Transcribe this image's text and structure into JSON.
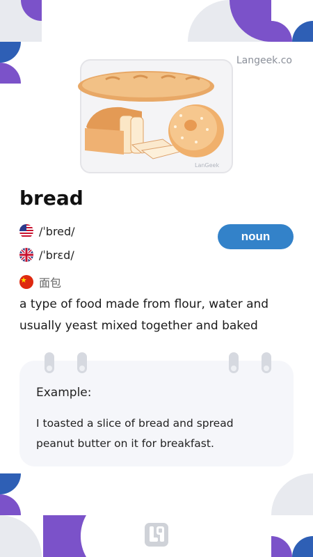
{
  "brand": {
    "name": "Langeek.co"
  },
  "illustration": {
    "icon": "bread-illustration",
    "watermark": "LanGeek"
  },
  "entry": {
    "word": "bread",
    "part_of_speech": "noun",
    "pronunciations": [
      {
        "flag": "us-flag-icon",
        "ipa": "/ˈbred/"
      },
      {
        "flag": "uk-flag-icon",
        "ipa": "/ˈbrɛd/"
      }
    ],
    "translation": {
      "flag": "china-flag-icon",
      "text": "面包"
    },
    "definition": "a type of food made from flour, water and usually yeast mixed together and baked"
  },
  "example": {
    "label": "Example:",
    "text": "I toasted a slice of bread and spread peanut butter on it for breakfast."
  },
  "colors": {
    "purple": "#7b52c9",
    "blue": "#2e5fb5",
    "gray": "#e8eaef",
    "pill": "#3382c9",
    "card": "#f5f6fa"
  }
}
